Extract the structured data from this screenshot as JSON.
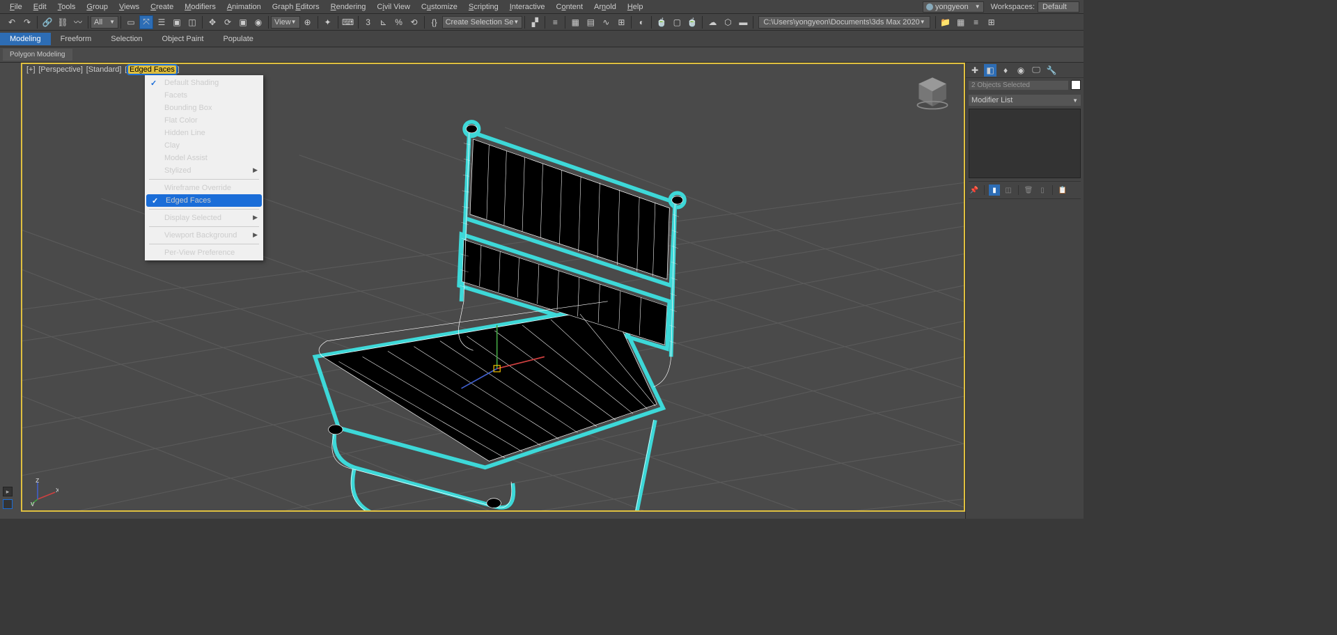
{
  "menubar": [
    "File",
    "Edit",
    "Tools",
    "Group",
    "Views",
    "Create",
    "Modifiers",
    "Animation",
    "Graph Editors",
    "Rendering",
    "Civil View",
    "Customize",
    "Scripting",
    "Interactive",
    "Content",
    "Arnold",
    "Help"
  ],
  "user": "yongyeon",
  "workspaces_label": "Workspaces:",
  "workspaces_value": "Default",
  "toolbar": {
    "filter": "All",
    "view": "View",
    "selset": "Create Selection Se",
    "path": "C:\\Users\\yongyeon\\Documents\\3ds Max 2020"
  },
  "ribbon_tabs": [
    "Modeling",
    "Freeform",
    "Selection",
    "Object Paint",
    "Populate"
  ],
  "sub_ribbon": "Polygon Modeling",
  "viewport": {
    "labels": [
      "[+]",
      "[Perspective]",
      "[Standard]"
    ],
    "edged": "Edged Faces"
  },
  "context_menu": [
    {
      "t": "Default Shading",
      "chk": true
    },
    {
      "t": "Facets"
    },
    {
      "t": "Bounding Box"
    },
    {
      "t": "Flat Color"
    },
    {
      "t": "Hidden Line"
    },
    {
      "t": "Clay"
    },
    {
      "t": "Model Assist"
    },
    {
      "t": "Stylized",
      "sub": true
    },
    {
      "sep": true
    },
    {
      "t": "Wireframe Override"
    },
    {
      "t": "Edged Faces",
      "chk": true,
      "hl": true
    },
    {
      "sep": true
    },
    {
      "t": "Display Selected",
      "sub": true
    },
    {
      "sep": true
    },
    {
      "t": "Viewport Background",
      "sub": true
    },
    {
      "sep": true
    },
    {
      "t": "Per-View Preference"
    }
  ],
  "rightpanel": {
    "selection": "2 Objects Selected",
    "modlist": "Modifier List"
  }
}
